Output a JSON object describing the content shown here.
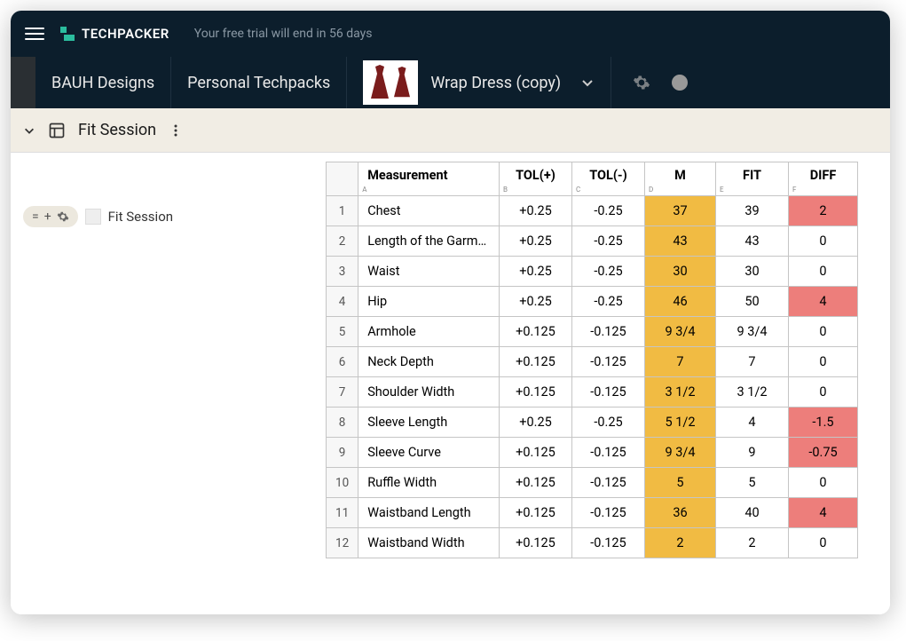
{
  "header": {
    "brand": "TECHPACKER",
    "trial_text": "Your free trial will end in 56 days"
  },
  "breadcrumbs": {
    "org": "BAUH Designs",
    "category": "Personal Techpacks",
    "product": "Wrap Dress (copy)"
  },
  "section": {
    "title": "Fit Session"
  },
  "left_panel": {
    "item_label": "Fit Session"
  },
  "table": {
    "headers": {
      "measurement": "Measurement",
      "tol_plus": "TOL(+)",
      "tol_minus": "TOL(-)",
      "m": "M",
      "fit": "FIT",
      "diff": "DIFF"
    },
    "col_letters": [
      "A",
      "B",
      "C",
      "D",
      "E",
      "F"
    ],
    "rows": [
      {
        "n": "1",
        "measurement": "Chest",
        "tp": "+0.25",
        "tm": "-0.25",
        "m": "37",
        "fit": "39",
        "diff": "2",
        "diff_hl": true
      },
      {
        "n": "2",
        "measurement": "Length of the Garment",
        "tp": "+0.25",
        "tm": "-0.25",
        "m": "43",
        "fit": "43",
        "diff": "0",
        "diff_hl": false
      },
      {
        "n": "3",
        "measurement": "Waist",
        "tp": "+0.25",
        "tm": "-0.25",
        "m": "30",
        "fit": "30",
        "diff": "0",
        "diff_hl": false
      },
      {
        "n": "4",
        "measurement": "Hip",
        "tp": "+0.25",
        "tm": "-0.25",
        "m": "46",
        "fit": "50",
        "diff": "4",
        "diff_hl": true
      },
      {
        "n": "5",
        "measurement": "Armhole",
        "tp": "+0.125",
        "tm": "-0.125",
        "m": "9 3/4",
        "fit": "9 3/4",
        "diff": "0",
        "diff_hl": false
      },
      {
        "n": "6",
        "measurement": "Neck Depth",
        "tp": "+0.125",
        "tm": "-0.125",
        "m": "7",
        "fit": "7",
        "diff": "0",
        "diff_hl": false
      },
      {
        "n": "7",
        "measurement": "Shoulder Width",
        "tp": "+0.125",
        "tm": "-0.125",
        "m": "3 1/2",
        "fit": "3 1/2",
        "diff": "0",
        "diff_hl": false
      },
      {
        "n": "8",
        "measurement": "Sleeve Length",
        "tp": "+0.25",
        "tm": "-0.25",
        "m": "5 1/2",
        "fit": "4",
        "diff": "-1.5",
        "diff_hl": true
      },
      {
        "n": "9",
        "measurement": "Sleeve Curve",
        "tp": "+0.125",
        "tm": "-0.125",
        "m": "9 3/4",
        "fit": "9",
        "diff": "-0.75",
        "diff_hl": true
      },
      {
        "n": "10",
        "measurement": "Ruffle Width",
        "tp": "+0.125",
        "tm": "-0.125",
        "m": "5",
        "fit": "5",
        "diff": "0",
        "diff_hl": false
      },
      {
        "n": "11",
        "measurement": "Waistband Length",
        "tp": "+0.125",
        "tm": "-0.125",
        "m": "36",
        "fit": "40",
        "diff": "4",
        "diff_hl": true
      },
      {
        "n": "12",
        "measurement": "Waistband Width",
        "tp": "+0.125",
        "tm": "-0.125",
        "m": "2",
        "fit": "2",
        "diff": "0",
        "diff_hl": false
      }
    ]
  }
}
